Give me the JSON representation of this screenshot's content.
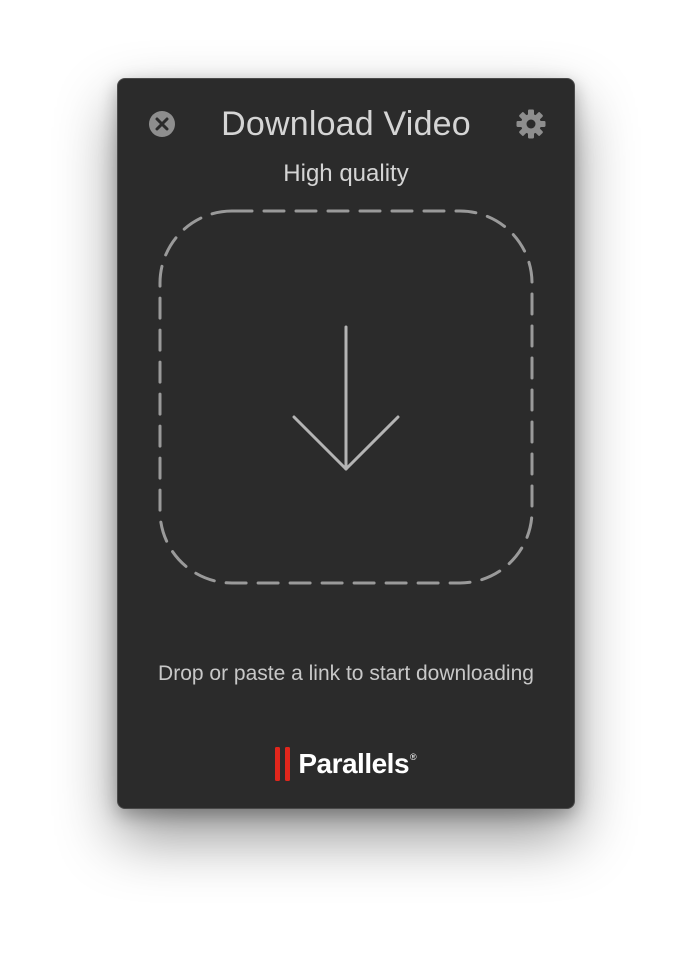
{
  "window": {
    "title": "Download Video",
    "quality_label": "High quality"
  },
  "dropzone": {
    "hint_text": "Drop or paste a link to start downloading"
  },
  "brand": {
    "name": "Parallels",
    "registered_mark": "®",
    "accent_color": "#e1261c"
  },
  "icons": {
    "close": "close-icon",
    "settings": "gear-icon",
    "drop": "arrow-down-icon"
  },
  "colors": {
    "window_background": "#2b2b2b",
    "text": "#d5d5d5",
    "icon": "#8e8e8e",
    "dashed_border": "#9a9a9a"
  }
}
